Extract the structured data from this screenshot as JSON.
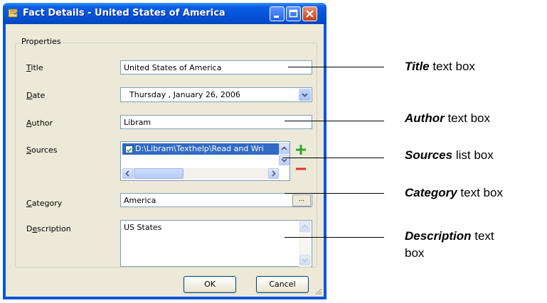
{
  "window": {
    "title": "Fact Details - United States of America"
  },
  "group": {
    "label": "Properties"
  },
  "fields": {
    "title": {
      "label_key": "T",
      "label_rest": "itle",
      "value": "United States of America"
    },
    "date": {
      "label_key": "D",
      "label_rest": "ate",
      "value": "Thursday  ,  January  26, 2006"
    },
    "author": {
      "label_key": "A",
      "label_rest": "uthor",
      "value": "Libram"
    },
    "sources": {
      "label_key": "S",
      "label_rest": "ources",
      "items": [
        "D:\\Libram\\Texthelp\\Read and Wri"
      ]
    },
    "category": {
      "label_key": "C",
      "label_rest": "ategory",
      "value": "America",
      "button": "..."
    },
    "description": {
      "label_pre": "D",
      "label_key": "e",
      "label_rest": "scription",
      "value": "US States"
    }
  },
  "buttons": {
    "ok": "OK",
    "cancel": "Cancel"
  },
  "callouts": {
    "title": {
      "bold": "Title",
      "rest": " text box"
    },
    "author": {
      "bold": "Author",
      "rest": " text box"
    },
    "sources": {
      "bold": "Sources",
      "rest": " list box"
    },
    "category": {
      "bold": "Category",
      "rest": " text box"
    },
    "description": {
      "bold": "Description",
      "rest": " text",
      "rest2": "box"
    }
  },
  "colors": {
    "titlebar": "#0553d6",
    "dialog_bg": "#ece9d8",
    "selection": "#316ac5",
    "add": "#2da52d",
    "remove": "#e03030"
  }
}
